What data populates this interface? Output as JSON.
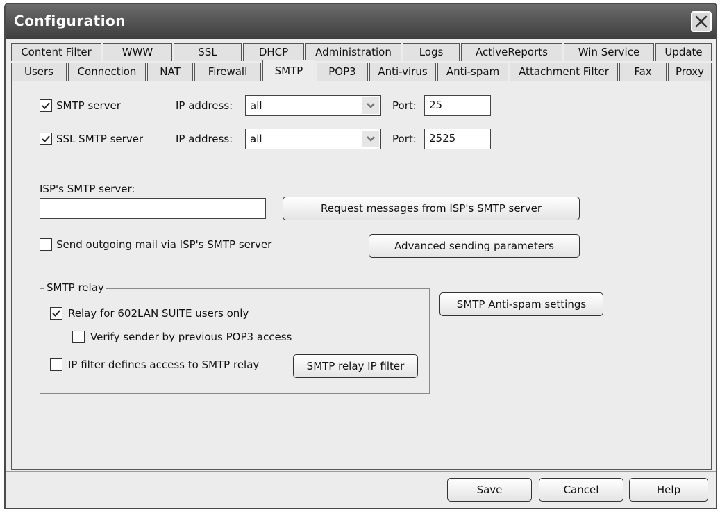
{
  "window": {
    "title": "Configuration"
  },
  "tabs_row1": [
    "Content Filter",
    "WWW",
    "SSL",
    "DHCP",
    "Administration",
    "Logs",
    "ActiveReports",
    "Win Service",
    "Update"
  ],
  "tabs_row2": [
    "Users",
    "Connection",
    "NAT",
    "Firewall",
    "SMTP",
    "POP3",
    "Anti-virus",
    "Anti-spam",
    "Attachment Filter",
    "Fax",
    "Proxy"
  ],
  "active_tab": "SMTP",
  "smtp": {
    "server_label": "SMTP server",
    "server_checked": true,
    "ip_label": "IP address:",
    "ip_value": "all",
    "port_label": "Port:",
    "port_value": "25",
    "ssl_label": "SSL SMTP server",
    "ssl_checked": true,
    "ssl_ip_label": "IP address:",
    "ssl_ip_value": "all",
    "ssl_port_label": "Port:",
    "ssl_port_value": "2525"
  },
  "isp": {
    "label": "ISP's SMTP server:",
    "value": "",
    "request_button": "Request messages from ISP's SMTP server",
    "send_via_label": "Send outgoing mail via ISP's SMTP server",
    "send_via_checked": false,
    "advanced_button": "Advanced sending parameters"
  },
  "relay": {
    "group_title": "SMTP relay",
    "users_only_label": "Relay for 602LAN SUITE users only",
    "users_only_checked": true,
    "verify_label": "Verify sender by previous POP3 access",
    "verify_checked": false,
    "ip_filter_label": "IP filter defines access to SMTP relay",
    "ip_filter_checked": false,
    "ip_filter_button": "SMTP relay IP filter"
  },
  "antispam_button": "SMTP Anti-spam settings",
  "footer": {
    "save": "Save",
    "cancel": "Cancel",
    "help": "Help"
  }
}
